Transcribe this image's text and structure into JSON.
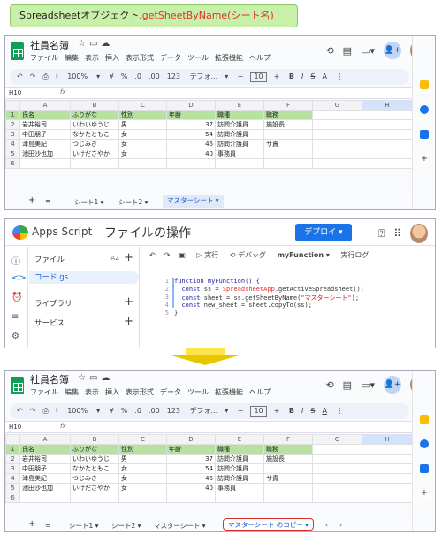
{
  "banner": {
    "prefix": "Spreadsheetオブジェクト.",
    "func": "getSheetByName(シート名)"
  },
  "sheet": {
    "doc_title": "社員名簿",
    "menu": [
      "ファイル",
      "編集",
      "表示",
      "挿入",
      "表示形式",
      "データ",
      "ツール",
      "拡張機能",
      "ヘルプ"
    ],
    "toolbar": {
      "zoom": "100%",
      "currency": "¥",
      "percent": "%",
      "dec_less": ".0",
      "dec_more": ".00",
      "num123": "123",
      "font": "デフォ...",
      "minus": "−",
      "size": "10",
      "plus": "+",
      "bold": "B",
      "italic": "I",
      "strike": "S",
      "underline": "A"
    },
    "cell_ref": "H10",
    "fx": "fx",
    "columns": [
      "A",
      "B",
      "C",
      "D",
      "E",
      "F",
      "G",
      "H"
    ],
    "rows": [
      [
        "氏名",
        "ふりがな",
        "性別",
        "年齢",
        "職種",
        "職務",
        "",
        ""
      ],
      [
        "岩井裕司",
        "いわいゆうじ",
        "男",
        "37",
        "訪問介護員",
        "施設長",
        "",
        ""
      ],
      [
        "中田朋子",
        "なかたともこ",
        "女",
        "54",
        "訪問介護員",
        "",
        "",
        ""
      ],
      [
        "津島美紀",
        "つじみき",
        "女",
        "46",
        "訪問介護員",
        "サ責",
        "",
        ""
      ],
      [
        "池田沙也加",
        "いけださやか",
        "女",
        "40",
        "事務員",
        "",
        "",
        ""
      ]
    ],
    "row_numbers": [
      "1",
      "2",
      "3",
      "4",
      "5",
      "6"
    ],
    "tabs_top": [
      "シート1 ▾",
      "シート2 ▾",
      "マスターシート ▾"
    ],
    "tabs_bottom": [
      "シート1 ▾",
      "シート2 ▾",
      "マスターシート ▾",
      "マスターシート のコピー ▾"
    ],
    "tab_add": "+",
    "tab_list": "≡"
  },
  "apps_script": {
    "brand": "Apps Script",
    "project": "ファイルの操作",
    "deploy": "デプロイ ▾",
    "files_label": "ファイル",
    "sort_label": "AZ",
    "file_item": "コード.gs",
    "libraries": "ライブラリ",
    "services": "サービス",
    "toolbar": {
      "run": "▷ 実行",
      "debug": "⟲ デバッグ",
      "fn": "myFunction ▾",
      "log": "実行ログ"
    },
    "code": [
      {
        "n": "1",
        "t": "function myFunction() {"
      },
      {
        "n": "2",
        "t": "  const ss = SpreadsheetApp.getActiveSpreadsheet();"
      },
      {
        "n": "3",
        "t": "  const sheet = ss.getSheetByName(\"マスターシート\");"
      },
      {
        "n": "4",
        "t": "  const new_sheet = sheet.copyTo(ss);"
      },
      {
        "n": "5",
        "t": "}"
      }
    ]
  }
}
